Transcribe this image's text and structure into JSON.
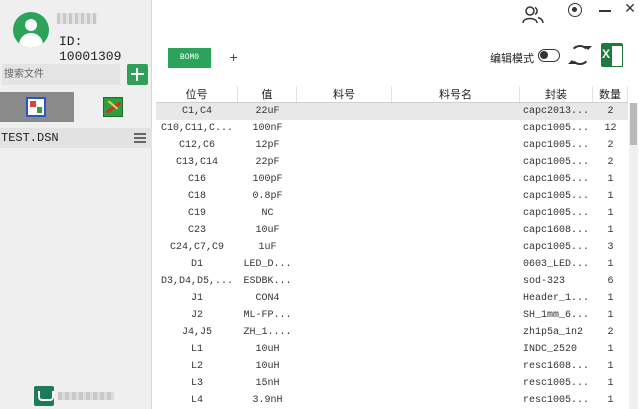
{
  "user": {
    "name": "",
    "id_label": "ID: 10001309"
  },
  "sidebar": {
    "search_placeholder": "搜索文件",
    "files": [
      {
        "name": "TEST.DSN"
      }
    ]
  },
  "toolbar": {
    "tabs": [
      {
        "label": "BOM0"
      }
    ],
    "add_tab": "+",
    "edit_mode_label": "编辑模式",
    "edit_mode_on": false
  },
  "table": {
    "headers": [
      "位号",
      "值",
      "料号",
      "料号名",
      "封装",
      "数量"
    ],
    "rows": [
      [
        "C1,C4",
        "22uF",
        "",
        "",
        "capc2013...",
        "2"
      ],
      [
        "C10,C11,C...",
        "100nF",
        "",
        "",
        "capc1005...",
        "12"
      ],
      [
        "C12,C6",
        "12pF",
        "",
        "",
        "capc1005...",
        "2"
      ],
      [
        "C13,C14",
        "22pF",
        "",
        "",
        "capc1005...",
        "2"
      ],
      [
        "C16",
        "100pF",
        "",
        "",
        "capc1005...",
        "1"
      ],
      [
        "C18",
        "0.8pF",
        "",
        "",
        "capc1005...",
        "1"
      ],
      [
        "C19",
        "NC",
        "",
        "",
        "capc1005...",
        "1"
      ],
      [
        "C23",
        "10uF",
        "",
        "",
        "capc1608...",
        "1"
      ],
      [
        "C24,C7,C9",
        "1uF",
        "",
        "",
        "capc1005...",
        "3"
      ],
      [
        "D1",
        "LED_D...",
        "",
        "",
        "0603_LED...",
        "1"
      ],
      [
        "D3,D4,D5,...",
        "ESDBK...",
        "",
        "",
        "sod-323",
        "6"
      ],
      [
        "J1",
        "CON4",
        "",
        "",
        "Header_1...",
        "1"
      ],
      [
        "J2",
        "ML-FP...",
        "",
        "",
        "SH_1mm_6...",
        "1"
      ],
      [
        "J4,J5",
        "ZH_1....",
        "",
        "",
        "zh1p5a_1n2",
        "2"
      ],
      [
        "L1",
        "10uH",
        "",
        "",
        "INDC_2520",
        "1"
      ],
      [
        "L2",
        "10uH",
        "",
        "",
        "resc1608...",
        "1"
      ],
      [
        "L3",
        "15nH",
        "",
        "",
        "resc1005...",
        "1"
      ],
      [
        "L4",
        "3.9nH",
        "",
        "",
        "resc1005...",
        "1"
      ]
    ],
    "selected_row": 0
  },
  "colors": {
    "accent": "#2ca35a",
    "selected_row": "#e8e8e8"
  },
  "icons": [
    "users-icon",
    "settings-icon",
    "minimize-icon",
    "close-icon",
    "refresh-icon",
    "excel-icon",
    "add-icon",
    "menu-icon"
  ]
}
